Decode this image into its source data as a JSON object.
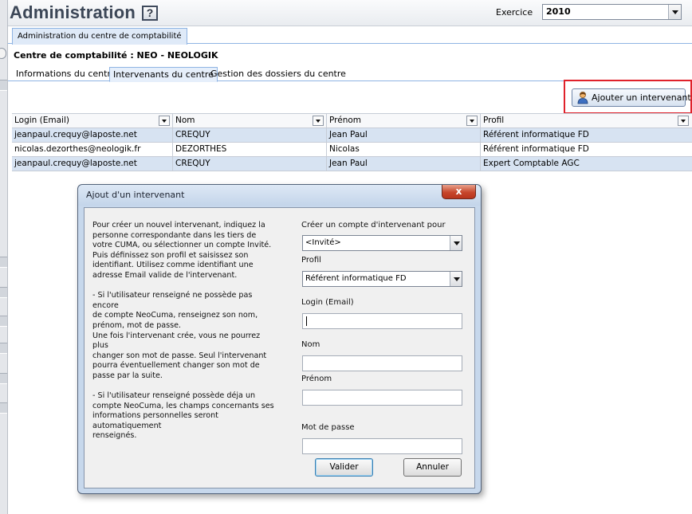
{
  "header": {
    "title": "Administration",
    "help_icon": "?",
    "exercice_label": "Exercice",
    "exercice_value": "2010"
  },
  "main_tab": {
    "label": "Administration du centre de comptabilité"
  },
  "centre": {
    "title": "Centre de comptabilité : NEO - NEOLOGIK"
  },
  "sub_tabs": [
    {
      "label": "Informations du centre"
    },
    {
      "label": "Intervenants du centre"
    },
    {
      "label": "Gestion des dossiers du centre"
    }
  ],
  "add_button": {
    "label": "Ajouter un intervenant",
    "icon": "person-icon"
  },
  "table": {
    "columns": [
      "Login (Email)",
      "Nom",
      "Prénom",
      "Profil"
    ],
    "rows": [
      [
        "jeanpaul.crequy@laposte.net",
        "CREQUY",
        "Jean Paul",
        "Référent informatique FD"
      ],
      [
        "nicolas.dezorthes@neologik.fr",
        "DEZORTHES",
        "Nicolas",
        "Référent informatique FD"
      ],
      [
        "jeanpaul.crequy@laposte.net",
        "CREQUY",
        "Jean Paul",
        "Expert Comptable AGC"
      ]
    ]
  },
  "dialog": {
    "title": "Ajout d'un intervenant",
    "close_label": "x",
    "help_text": "Pour créer un nouvel intervenant, indiquez la\npersonne correspondante dans les tiers de\nvotre CUMA, ou sélectionner un compte Invité.\nPuis définissez son profil et saisissez son\nidentifiant. Utilisez comme identifiant une\nadresse Email valide de l'intervenant.\n\n- Si l'utilisateur renseigné ne possède pas encore\nde compte NeoCuma, renseignez son nom,\nprénom, mot de passe.\nUne fois l'intervenant crée, vous ne pourrez plus\nchanger son mot de passe. Seul l'intervenant\npourra éventuellement changer son mot de\npasse par la suite.\n\n- Si l'utilisateur renseigné possède déja un\ncompte NeoCuma, les champs concernants ses\ninformations personnelles seront\nautomatiquement\nrenseignés.",
    "account_label": "Créer un compte d'intervenant pour",
    "account_value": "<Invité>",
    "profil_label": "Profil",
    "profil_value": "Référent informatique FD",
    "login_label": "Login (Email)",
    "login_value": "",
    "nom_label": "Nom",
    "nom_value": "",
    "prenom_label": "Prénom",
    "prenom_value": "",
    "password_label": "Mot de passe",
    "password_value": "",
    "validate_label": "Valider",
    "cancel_label": "Annuler"
  }
}
